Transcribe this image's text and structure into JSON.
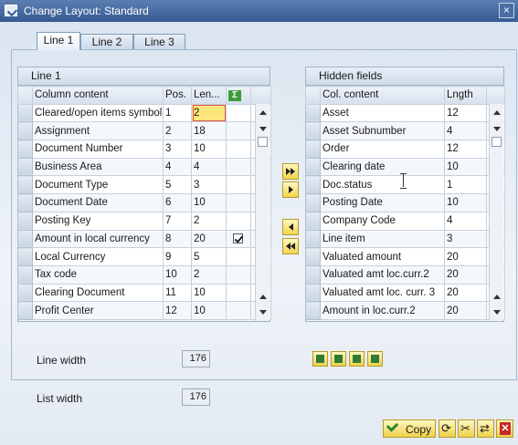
{
  "window": {
    "title": "Change Layout: Standard",
    "close_glyph": "×"
  },
  "tabs": [
    {
      "label": "Line 1",
      "active": true
    },
    {
      "label": "Line 2",
      "active": false
    },
    {
      "label": "Line 3",
      "active": false
    }
  ],
  "left_panel": {
    "title": "Line 1",
    "columns": {
      "content": "Column content",
      "pos": "Pos.",
      "len": "Len..."
    },
    "sum_icon": "sum-icon",
    "rows": [
      {
        "content": "Cleared/open items symbol",
        "pos": "1",
        "len": "2",
        "total": false
      },
      {
        "content": "Assignment",
        "pos": "2",
        "len": "18",
        "total": false
      },
      {
        "content": "Document Number",
        "pos": "3",
        "len": "10",
        "total": false
      },
      {
        "content": "Business Area",
        "pos": "4",
        "len": "4",
        "total": false
      },
      {
        "content": "Document Type",
        "pos": "5",
        "len": "3",
        "total": false
      },
      {
        "content": "Document Date",
        "pos": "6",
        "len": "10",
        "total": false
      },
      {
        "content": "Posting Key",
        "pos": "7",
        "len": "2",
        "total": false
      },
      {
        "content": "Amount in local currency",
        "pos": "8",
        "len": "20",
        "total": true
      },
      {
        "content": "Local Currency",
        "pos": "9",
        "len": "5",
        "total": false
      },
      {
        "content": "Tax code",
        "pos": "10",
        "len": "2",
        "total": false
      },
      {
        "content": "Clearing Document",
        "pos": "11",
        "len": "10",
        "total": false
      },
      {
        "content": "Profit Center",
        "pos": "12",
        "len": "10",
        "total": false
      }
    ]
  },
  "right_panel": {
    "title": "Hidden fields",
    "columns": {
      "content": "Col. content",
      "len": "Lngth"
    },
    "rows": [
      {
        "content": "Asset",
        "len": "12"
      },
      {
        "content": "Asset Subnumber",
        "len": "4"
      },
      {
        "content": "Order",
        "len": "12"
      },
      {
        "content": "Clearing date",
        "len": "10"
      },
      {
        "content": "Doc.status",
        "len": "1"
      },
      {
        "content": "Posting Date",
        "len": "10"
      },
      {
        "content": "Company Code",
        "len": "4"
      },
      {
        "content": "Line item",
        "len": "3"
      },
      {
        "content": "Valuated amount",
        "len": "20"
      },
      {
        "content": "Valuated amt loc.curr.2",
        "len": "20"
      },
      {
        "content": "Valuated amt loc. curr. 3",
        "len": "20"
      },
      {
        "content": "Amount in loc.curr.2",
        "len": "20"
      }
    ]
  },
  "move_buttons": [
    "move-all-right-icon",
    "move-right-icon",
    "move-left-icon",
    "move-all-left-icon"
  ],
  "fields": {
    "line_width_label": "Line width",
    "line_width_value": "176",
    "list_width_label": "List width",
    "list_width_value": "176"
  },
  "toolbar_icons": [
    "align-bottom-icon",
    "filter-icon",
    "find-icon",
    "find-next-icon"
  ],
  "footer": {
    "copy_label": "Copy",
    "icons": [
      "refresh-icon",
      "cut-icon",
      "transfer-icon",
      "cancel-icon"
    ]
  },
  "colors": {
    "title_bar": "#345a91",
    "highlight_cell": "#ffe67a",
    "button_yellow": "#f2d64c"
  }
}
